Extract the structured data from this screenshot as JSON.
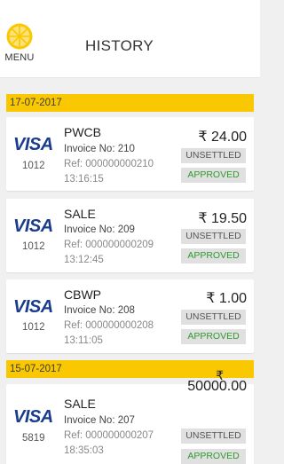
{
  "header": {
    "menu_label": "MENU",
    "title": "HISTORY",
    "menu_icon": "lemon-slice-icon"
  },
  "colors": {
    "accent": "#f9c800",
    "visa_blue": "#1a3c8f",
    "approved_green": "#2e9b2e"
  },
  "groups": [
    {
      "date": "17-07-2017",
      "transactions": [
        {
          "card_brand": "VISA",
          "last4": "1012",
          "type": "PWCB",
          "invoice": "Invoice No: 210",
          "ref": "Ref: 000000000210",
          "time": "13:16:15",
          "amount": "₹ 24.00",
          "settlement": "UNSETTLED",
          "status": "APPROVED"
        },
        {
          "card_brand": "VISA",
          "last4": "1012",
          "type": "SALE",
          "invoice": "Invoice No: 209",
          "ref": "Ref: 000000000209",
          "time": "13:12:45",
          "amount": "₹ 19.50",
          "settlement": "UNSETTLED",
          "status": "APPROVED"
        },
        {
          "card_brand": "VISA",
          "last4": "1012",
          "type": "CBWP",
          "invoice": "Invoice No: 208",
          "ref": "Ref: 000000000208",
          "time": "13:11:05",
          "amount": "₹ 1.00",
          "settlement": "UNSETTLED",
          "status": "APPROVED"
        }
      ]
    },
    {
      "date": "15-07-2017",
      "transactions": [
        {
          "card_brand": "VISA",
          "last4": "5819",
          "type": "SALE",
          "invoice": "Invoice No: 207",
          "ref": "Ref: 000000000207",
          "time": "18:35:03",
          "amount_symbol": "₹",
          "amount_value": "50000.00",
          "settlement": "UNSETTLED",
          "status": "APPROVED"
        }
      ]
    }
  ]
}
